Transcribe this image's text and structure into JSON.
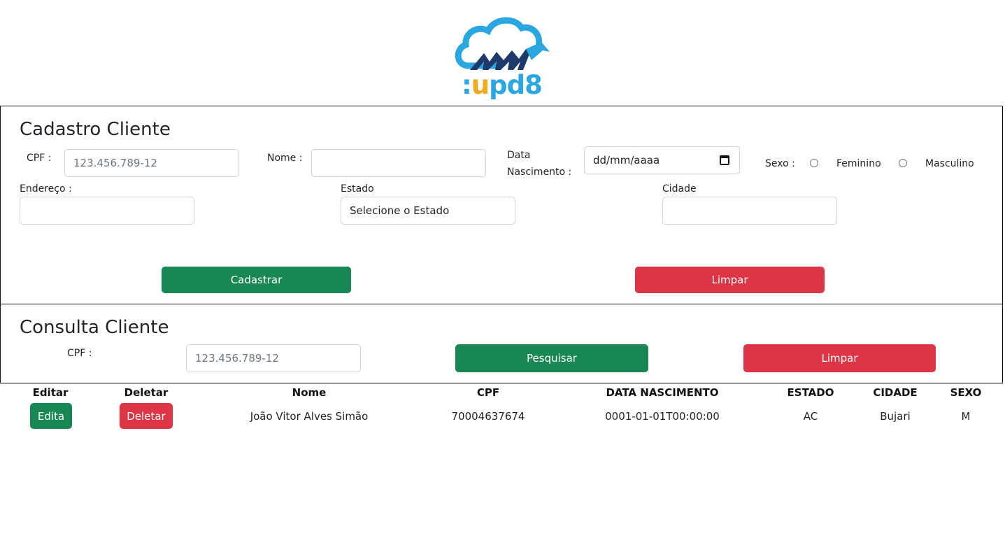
{
  "logo": {
    "colon": ":",
    "u": "u",
    "rest": "pd8"
  },
  "cadastro": {
    "title": "Cadastro Cliente",
    "cpf_label": "CPF :",
    "cpf_placeholder": "123.456.789-12",
    "nome_label": "Nome :",
    "data_label_line1": "Data",
    "data_label_line2": "Nascimento :",
    "data_value": "dd/mm/aaaa",
    "sexo_label": "Sexo :",
    "sexo_options": [
      "Feminino",
      "Masculino"
    ],
    "endereco_label": "Endereço :",
    "estado_label": "Estado",
    "estado_value": "Selecione o Estado",
    "cidade_label": "Cidade",
    "cadastrar_label": "Cadastrar",
    "limpar_label": "Limpar"
  },
  "consulta": {
    "title": "Consulta Cliente",
    "cpf_label": "CPF :",
    "cpf_placeholder": "123.456.789-12",
    "pesquisar_label": "Pesquisar",
    "limpar_label": "Limpar"
  },
  "table": {
    "headers": [
      "Editar",
      "Deletar",
      "Nome",
      "CPF",
      "DATA NASCIMENTO",
      "ESTADO",
      "CIDADE",
      "SEXO"
    ],
    "rows": [
      {
        "edit_label": "Edita",
        "delete_label": "Deletar",
        "nome": "João Vitor Alves Simão",
        "cpf": "70004637674",
        "data_nascimento": "0001-01-01T00:00:00",
        "estado": "AC",
        "cidade": "Bujari",
        "sexo": "M"
      }
    ]
  },
  "colors": {
    "green": "#198754",
    "red": "#dc3545",
    "logo_blue": "#2aa6e0",
    "logo_orange": "#f6a81c",
    "logo_navy": "#1d3a6b"
  }
}
